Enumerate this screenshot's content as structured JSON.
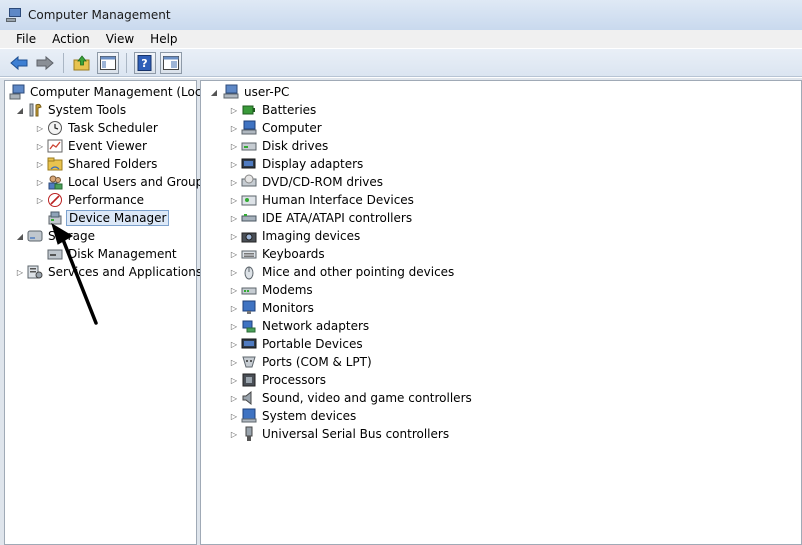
{
  "window": {
    "title": "Computer Management"
  },
  "menu": [
    "File",
    "Action",
    "View",
    "Help"
  ],
  "toolbar": {
    "icons": [
      "back-arrow-icon",
      "forward-arrow-icon",
      "up-folder-icon",
      "show-hide-tree-icon",
      "help-icon",
      "console-icon"
    ]
  },
  "left_tree": {
    "root": "Computer Management (Local",
    "system_tools": "System Tools",
    "task_scheduler": "Task Scheduler",
    "event_viewer": "Event Viewer",
    "shared_folders": "Shared Folders",
    "local_users": "Local Users and Groups",
    "performance": "Performance",
    "device_manager": "Device Manager",
    "storage": "Storage",
    "disk_management": "Disk Management",
    "services": "Services and Applications"
  },
  "right_tree": {
    "root": "user-PC",
    "items": [
      {
        "label": "Batteries",
        "icon": "battery-icon"
      },
      {
        "label": "Computer",
        "icon": "computer-icon"
      },
      {
        "label": "Disk drives",
        "icon": "disk-drive-icon"
      },
      {
        "label": "Display adapters",
        "icon": "display-adapter-icon"
      },
      {
        "label": "DVD/CD-ROM drives",
        "icon": "dvd-drive-icon"
      },
      {
        "label": "Human Interface Devices",
        "icon": "hid-icon"
      },
      {
        "label": "IDE ATA/ATAPI controllers",
        "icon": "ide-controller-icon"
      },
      {
        "label": "Imaging devices",
        "icon": "camera-icon"
      },
      {
        "label": "Keyboards",
        "icon": "keyboard-icon"
      },
      {
        "label": "Mice and other pointing devices",
        "icon": "mouse-icon"
      },
      {
        "label": "Modems",
        "icon": "modem-icon"
      },
      {
        "label": "Monitors",
        "icon": "monitor-icon"
      },
      {
        "label": "Network adapters",
        "icon": "network-adapter-icon"
      },
      {
        "label": "Portable Devices",
        "icon": "portable-device-icon"
      },
      {
        "label": "Ports (COM & LPT)",
        "icon": "port-icon"
      },
      {
        "label": "Processors",
        "icon": "processor-icon"
      },
      {
        "label": "Sound, video and game controllers",
        "icon": "speaker-icon"
      },
      {
        "label": "System devices",
        "icon": "system-devices-icon"
      },
      {
        "label": "Universal Serial Bus controllers",
        "icon": "usb-icon"
      }
    ]
  },
  "colors": {
    "selection_bg": "#dce8f7",
    "selection_border": "#7da2ce",
    "annotation_arrow": "#000000"
  }
}
